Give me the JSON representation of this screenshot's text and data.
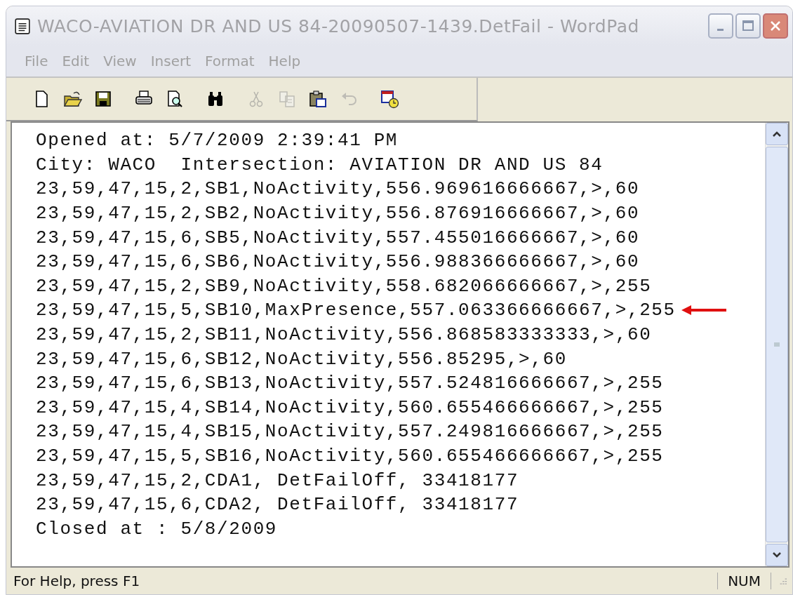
{
  "window": {
    "title": "WACO-AVIATION DR AND US 84-20090507-1439.DetFail - WordPad",
    "active": false
  },
  "menu": [
    "File",
    "Edit",
    "View",
    "Insert",
    "Format",
    "Help"
  ],
  "toolbar": [
    {
      "kind": "new",
      "disabled": false
    },
    {
      "kind": "open",
      "disabled": false
    },
    {
      "kind": "save",
      "disabled": false
    },
    {
      "kind": "print",
      "disabled": false
    },
    {
      "kind": "preview",
      "disabled": false
    },
    {
      "kind": "find",
      "disabled": false
    },
    {
      "kind": "cut",
      "disabled": true
    },
    {
      "kind": "copy",
      "disabled": true
    },
    {
      "kind": "paste",
      "disabled": false
    },
    {
      "kind": "undo",
      "disabled": true
    },
    {
      "kind": "datetime",
      "disabled": false
    }
  ],
  "document": {
    "lines": [
      {
        "text": "Opened at: 5/7/2009 2:39:41 PM",
        "marked": false
      },
      {
        "text": "City: WACO  Intersection: AVIATION DR AND US 84",
        "marked": false
      },
      {
        "text": "23,59,47,15,2,SB1,NoActivity,556.969616666667,>,60",
        "marked": false
      },
      {
        "text": "23,59,47,15,2,SB2,NoActivity,556.876916666667,>,60",
        "marked": false
      },
      {
        "text": "23,59,47,15,6,SB5,NoActivity,557.455016666667,>,60",
        "marked": false
      },
      {
        "text": "23,59,47,15,6,SB6,NoActivity,556.988366666667,>,60",
        "marked": false
      },
      {
        "text": "23,59,47,15,2,SB9,NoActivity,558.682066666667,>,255",
        "marked": false
      },
      {
        "text": "23,59,47,15,5,SB10,MaxPresence,557.063366666667,>,255",
        "marked": true
      },
      {
        "text": "23,59,47,15,2,SB11,NoActivity,556.868583333333,>,60",
        "marked": false
      },
      {
        "text": "23,59,47,15,6,SB12,NoActivity,556.85295,>,60",
        "marked": false
      },
      {
        "text": "23,59,47,15,6,SB13,NoActivity,557.524816666667,>,255",
        "marked": false
      },
      {
        "text": "23,59,47,15,4,SB14,NoActivity,560.655466666667,>,255",
        "marked": false
      },
      {
        "text": "23,59,47,15,4,SB15,NoActivity,557.249816666667,>,255",
        "marked": false
      },
      {
        "text": "23,59,47,15,5,SB16,NoActivity,560.655466666667,>,255",
        "marked": false
      },
      {
        "text": "23,59,47,15,2,CDA1, DetFailOff, 33418177",
        "marked": false
      },
      {
        "text": "23,59,47,15,6,CDA2, DetFailOff, 33418177",
        "marked": false
      },
      {
        "text": "Closed at : 5/8/2009",
        "marked": false
      }
    ]
  },
  "status_bar": {
    "help": "For Help, press F1",
    "num": "NUM"
  }
}
